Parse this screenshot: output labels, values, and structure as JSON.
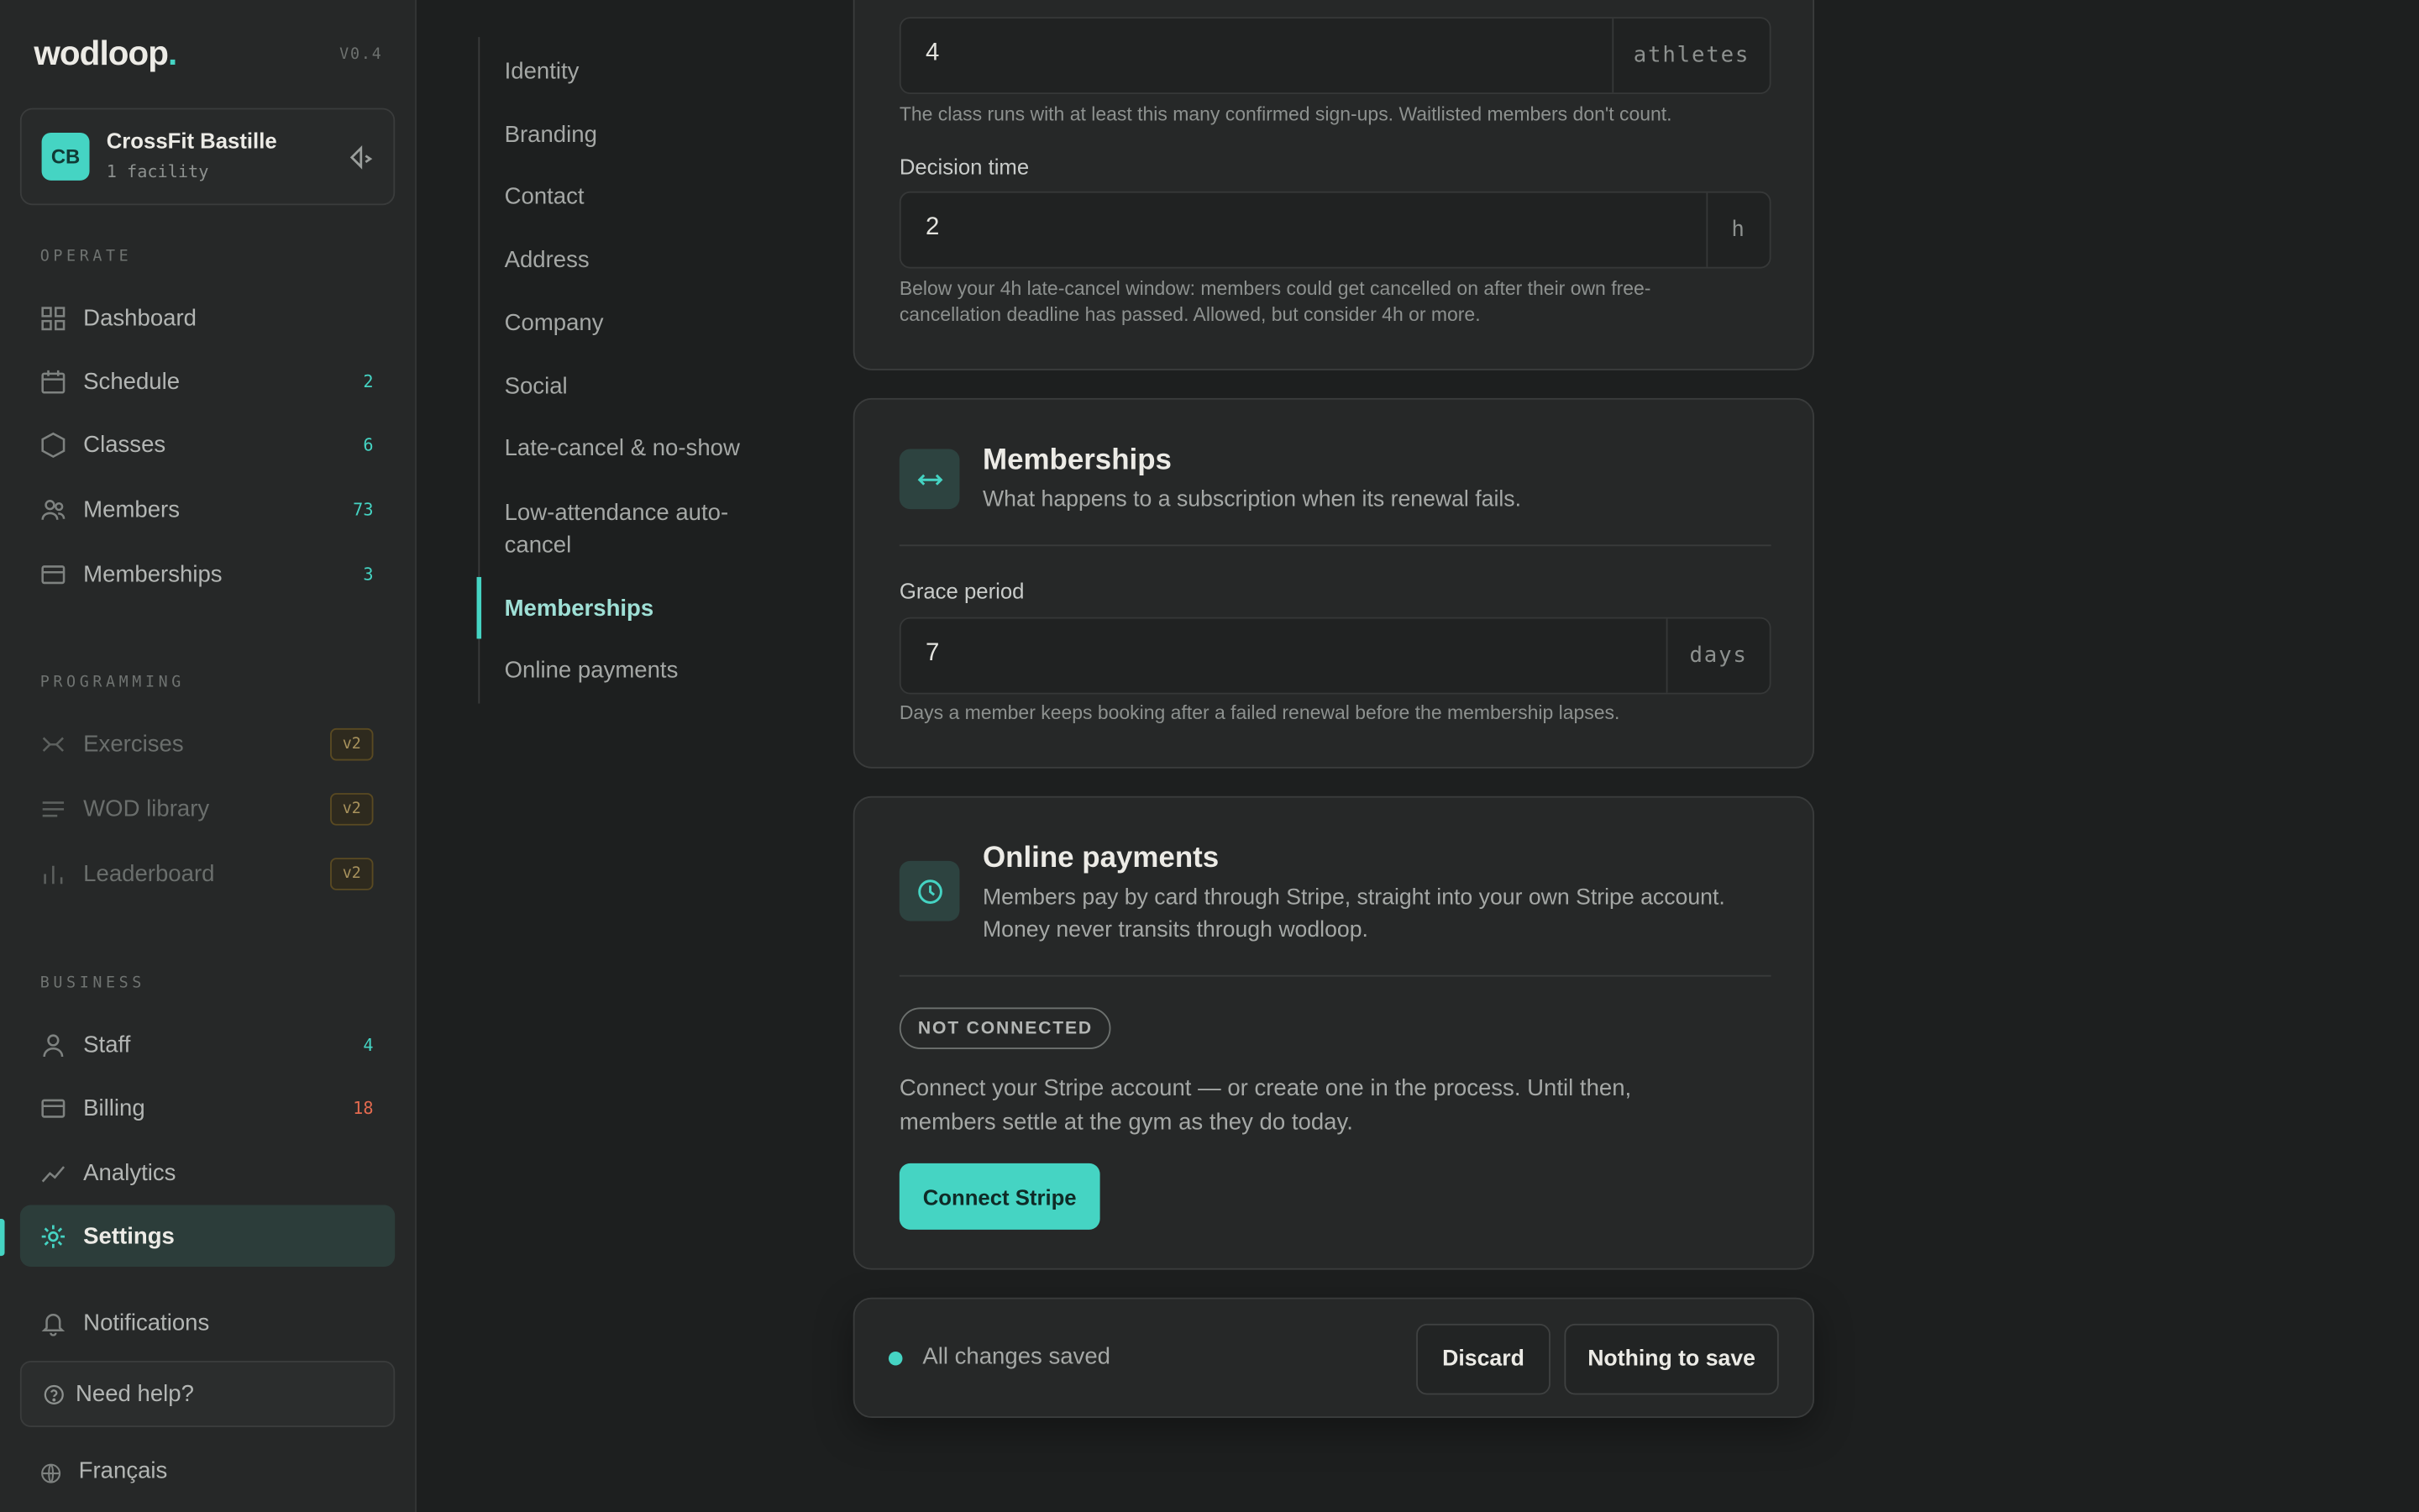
{
  "app": {
    "logo": "wodloop",
    "logo_dot": ".",
    "version": "V0.4"
  },
  "org": {
    "initials": "CB",
    "name": "CrossFit Bastille",
    "facilities": "1 facility"
  },
  "sidebar": {
    "sections": {
      "operate": "OPERATE",
      "programming": "PROGRAMMING",
      "business": "BUSINESS"
    },
    "operate": [
      {
        "label": "Dashboard",
        "icon": "grid-icon",
        "count": ""
      },
      {
        "label": "Schedule",
        "icon": "calendar-icon",
        "count": "2"
      },
      {
        "label": "Classes",
        "icon": "hexagon-icon",
        "count": "6"
      },
      {
        "label": "Members",
        "icon": "users-icon",
        "count": "73"
      },
      {
        "label": "Memberships",
        "icon": "card-icon",
        "count": "3"
      }
    ],
    "programming": [
      {
        "label": "Exercises",
        "icon": "dumbbell-icon",
        "badge": "v2"
      },
      {
        "label": "WOD library",
        "icon": "lines-icon",
        "badge": "v2"
      },
      {
        "label": "Leaderboard",
        "icon": "bars-icon",
        "badge": "v2"
      }
    ],
    "business": [
      {
        "label": "Staff",
        "icon": "user-icon",
        "count": "4"
      },
      {
        "label": "Billing",
        "icon": "card-icon",
        "count": "18"
      },
      {
        "label": "Analytics",
        "icon": "trend-icon",
        "count": ""
      },
      {
        "label": "Settings",
        "icon": "gear-icon",
        "count": ""
      }
    ],
    "notifications": "Notifications",
    "help": "Need help?",
    "language": "Français"
  },
  "subnav": {
    "items": [
      "Identity",
      "Branding",
      "Contact",
      "Address",
      "Company",
      "Social",
      "Late-cancel & no-show",
      "Low-attendance auto-cancel",
      "Memberships",
      "Online payments"
    ],
    "active": "Memberships"
  },
  "low_attendance": {
    "min_value": "4",
    "min_unit": "athletes",
    "min_help": "The class runs with at least this many confirmed sign-ups. Waitlisted members don't count.",
    "decision_label": "Decision time",
    "decision_value": "2",
    "decision_unit": "h",
    "decision_help": "Below your 4h late-cancel window: members could get cancelled on after their own free-cancellation deadline has passed. Allowed, but consider 4h or more."
  },
  "memberships": {
    "title": "Memberships",
    "subtitle": "What happens to a subscription when its renewal fails.",
    "grace_label": "Grace period",
    "grace_value": "7",
    "grace_unit": "days",
    "grace_help": "Days a member keeps booking after a failed renewal before the membership lapses."
  },
  "payments": {
    "title": "Online payments",
    "subtitle": "Members pay by card through Stripe, straight into your own Stripe account. Money never transits through wodloop.",
    "badge": "NOT CONNECTED",
    "body": "Connect your Stripe account — or create one in the process. Until then, members settle at the gym as they do today.",
    "button": "Connect Stripe"
  },
  "savebar": {
    "status": "All changes saved",
    "discard": "Discard",
    "save": "Nothing to save"
  },
  "colors": {
    "accent": "#45d4c3",
    "alert": "#e36a4f",
    "background": "#1d1f1f",
    "panel": "#262828"
  }
}
